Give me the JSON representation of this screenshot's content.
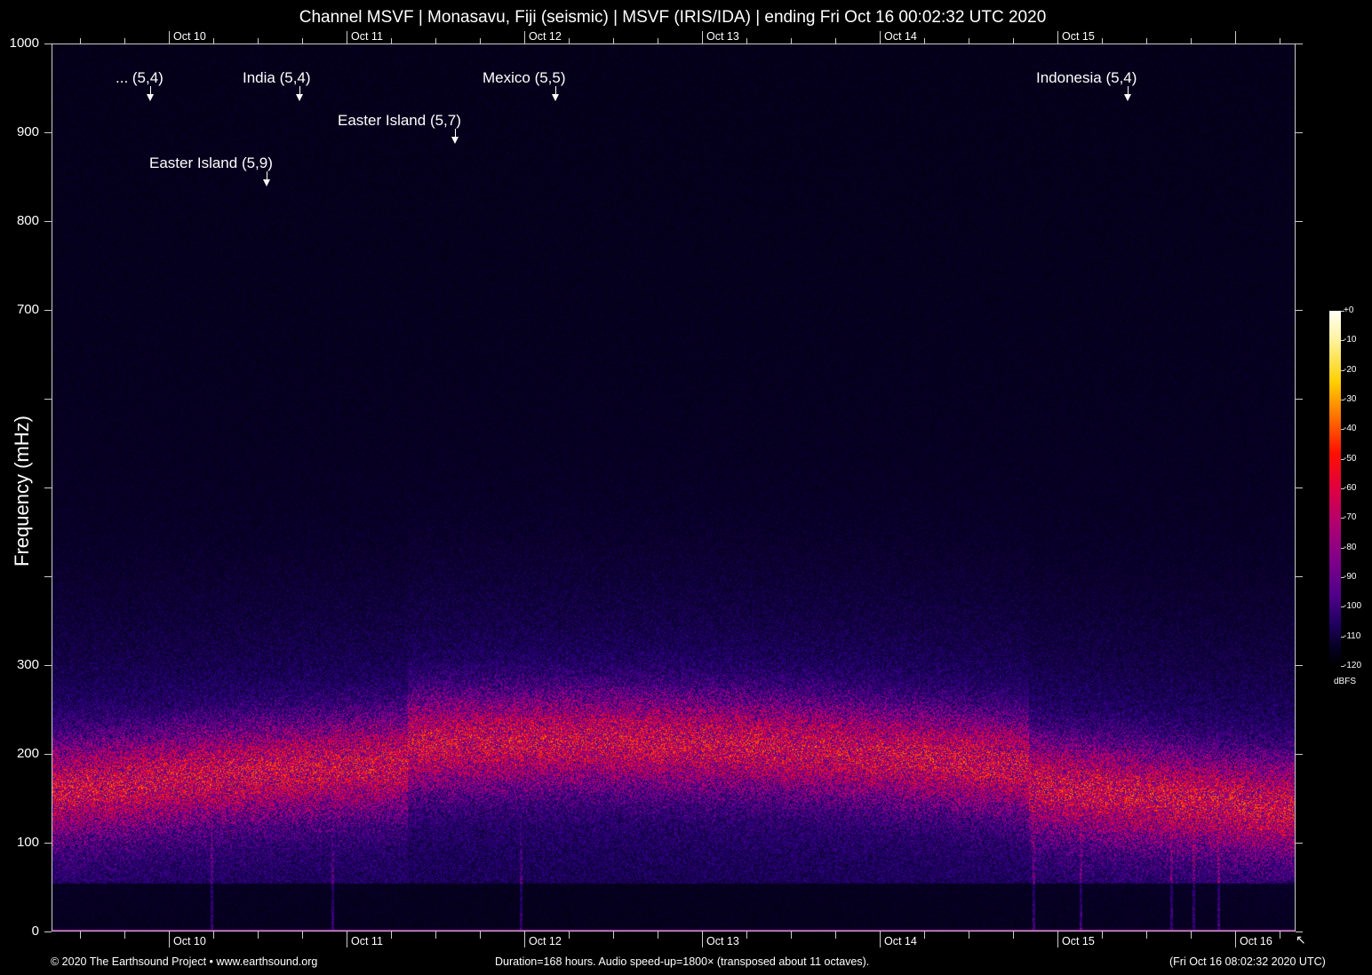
{
  "chart_data": {
    "type": "heatmap",
    "title": "Channel MSVF | Monasavu, Fiji (seismic) | MSVF (IRIS/IDA) | ending Fri Oct 16 00:02:32 UTC 2020",
    "ylabel": "Frequency (mHz)",
    "ylim": [
      0,
      1000
    ],
    "yticks": [
      0,
      100,
      200,
      300,
      400,
      500,
      600,
      700,
      800,
      900,
      1000
    ],
    "ytick_labels": [
      "0",
      "100",
      "200",
      "300",
      "",
      "",
      "",
      "700",
      "800",
      "900",
      "1000"
    ],
    "xticks_top": [
      "Oct 10",
      "Oct 11",
      "Oct 12",
      "Oct 13",
      "Oct 14",
      "Oct 15"
    ],
    "xticks_bottom": [
      "Oct 10",
      "Oct 11",
      "Oct 12",
      "Oct 13",
      "Oct 14",
      "Oct 15",
      "Oct 16"
    ],
    "duration_hours": 168,
    "colorbar": {
      "label": "dBFS",
      "range": [
        -120,
        0
      ],
      "ticks": [
        "+0",
        "-10",
        "-20",
        "-30",
        "-40",
        "-50",
        "-60",
        "-70",
        "-80",
        "-90",
        "-100",
        "-110",
        "-120"
      ]
    },
    "energy_band_mHz": [
      120,
      230
    ],
    "events": [
      {
        "label": "... (5,4)"
      },
      {
        "label": "India (5,4)"
      },
      {
        "label": "Easter Island (5,9)"
      },
      {
        "label": "Easter Island (5,7)"
      },
      {
        "label": "Mexico (5,5)"
      },
      {
        "label": "Indonesia (5,4)"
      }
    ]
  },
  "footer": {
    "left": "© 2020 The Earthsound Project • www.earthsound.org",
    "center": "Duration=168 hours. Audio speed-up=1800× (transposed about 11 octaves).",
    "right": "(Fri Oct 16 08:02:32 2020 UTC)"
  }
}
